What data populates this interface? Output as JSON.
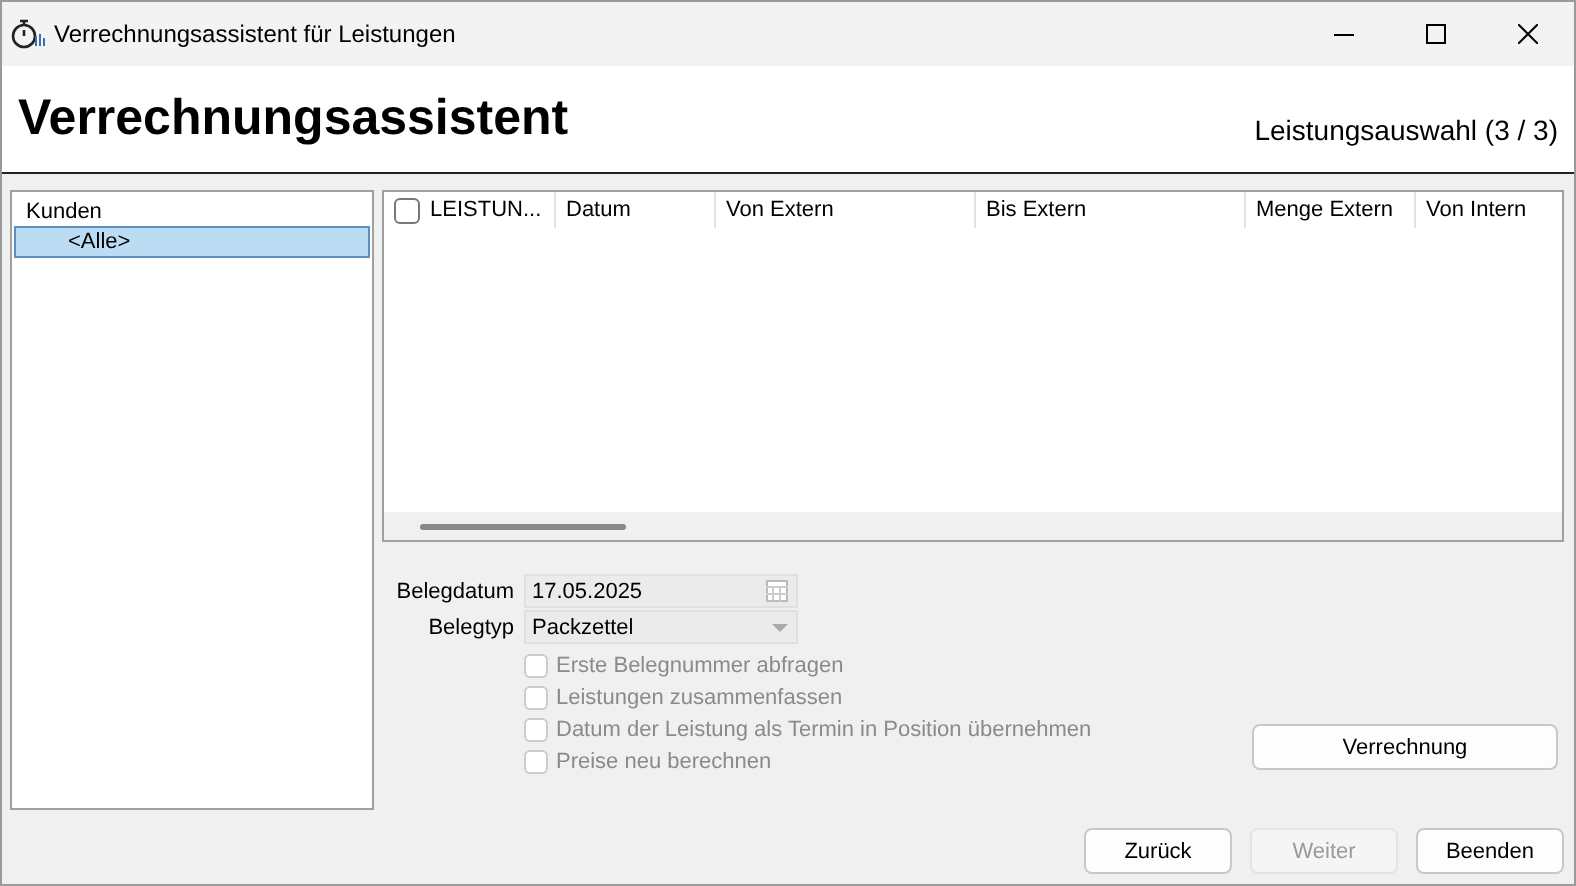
{
  "window": {
    "title": "Verrechnungsassistent für Leistungen"
  },
  "header": {
    "title": "Verrechnungsassistent",
    "step": "Leistungsauswahl (3 / 3)"
  },
  "customers": {
    "heading": "Kunden",
    "items": [
      {
        "label": "<Alle>",
        "selected": true
      }
    ]
  },
  "table": {
    "select_all_checked": false,
    "columns": [
      "LEISTUN...",
      "Datum",
      "Von Extern",
      "Bis Extern",
      "Menge Extern",
      "Von Intern"
    ]
  },
  "form": {
    "belegdatum": {
      "label": "Belegdatum",
      "value": "17.05.2025"
    },
    "belegtyp": {
      "label": "Belegtyp",
      "value": "Packzettel"
    },
    "options": [
      {
        "label": "Erste Belegnummer abfragen",
        "checked": false,
        "disabled": true
      },
      {
        "label": "Leistungen zusammenfassen",
        "checked": false,
        "disabled": true
      },
      {
        "label": "Datum der Leistung als Termin in Position übernehmen",
        "checked": false,
        "disabled": true
      },
      {
        "label": "Preise neu berechnen",
        "checked": false,
        "disabled": true
      }
    ]
  },
  "buttons": [
    {
      "kind": "action",
      "label": "Verrechnung",
      "disabled": false
    },
    {
      "kind": "nav",
      "label": "Zurück",
      "disabled": false
    },
    {
      "kind": "nav",
      "label": "Weiter",
      "disabled": true
    },
    {
      "kind": "nav",
      "label": "Beenden",
      "disabled": false
    }
  ]
}
